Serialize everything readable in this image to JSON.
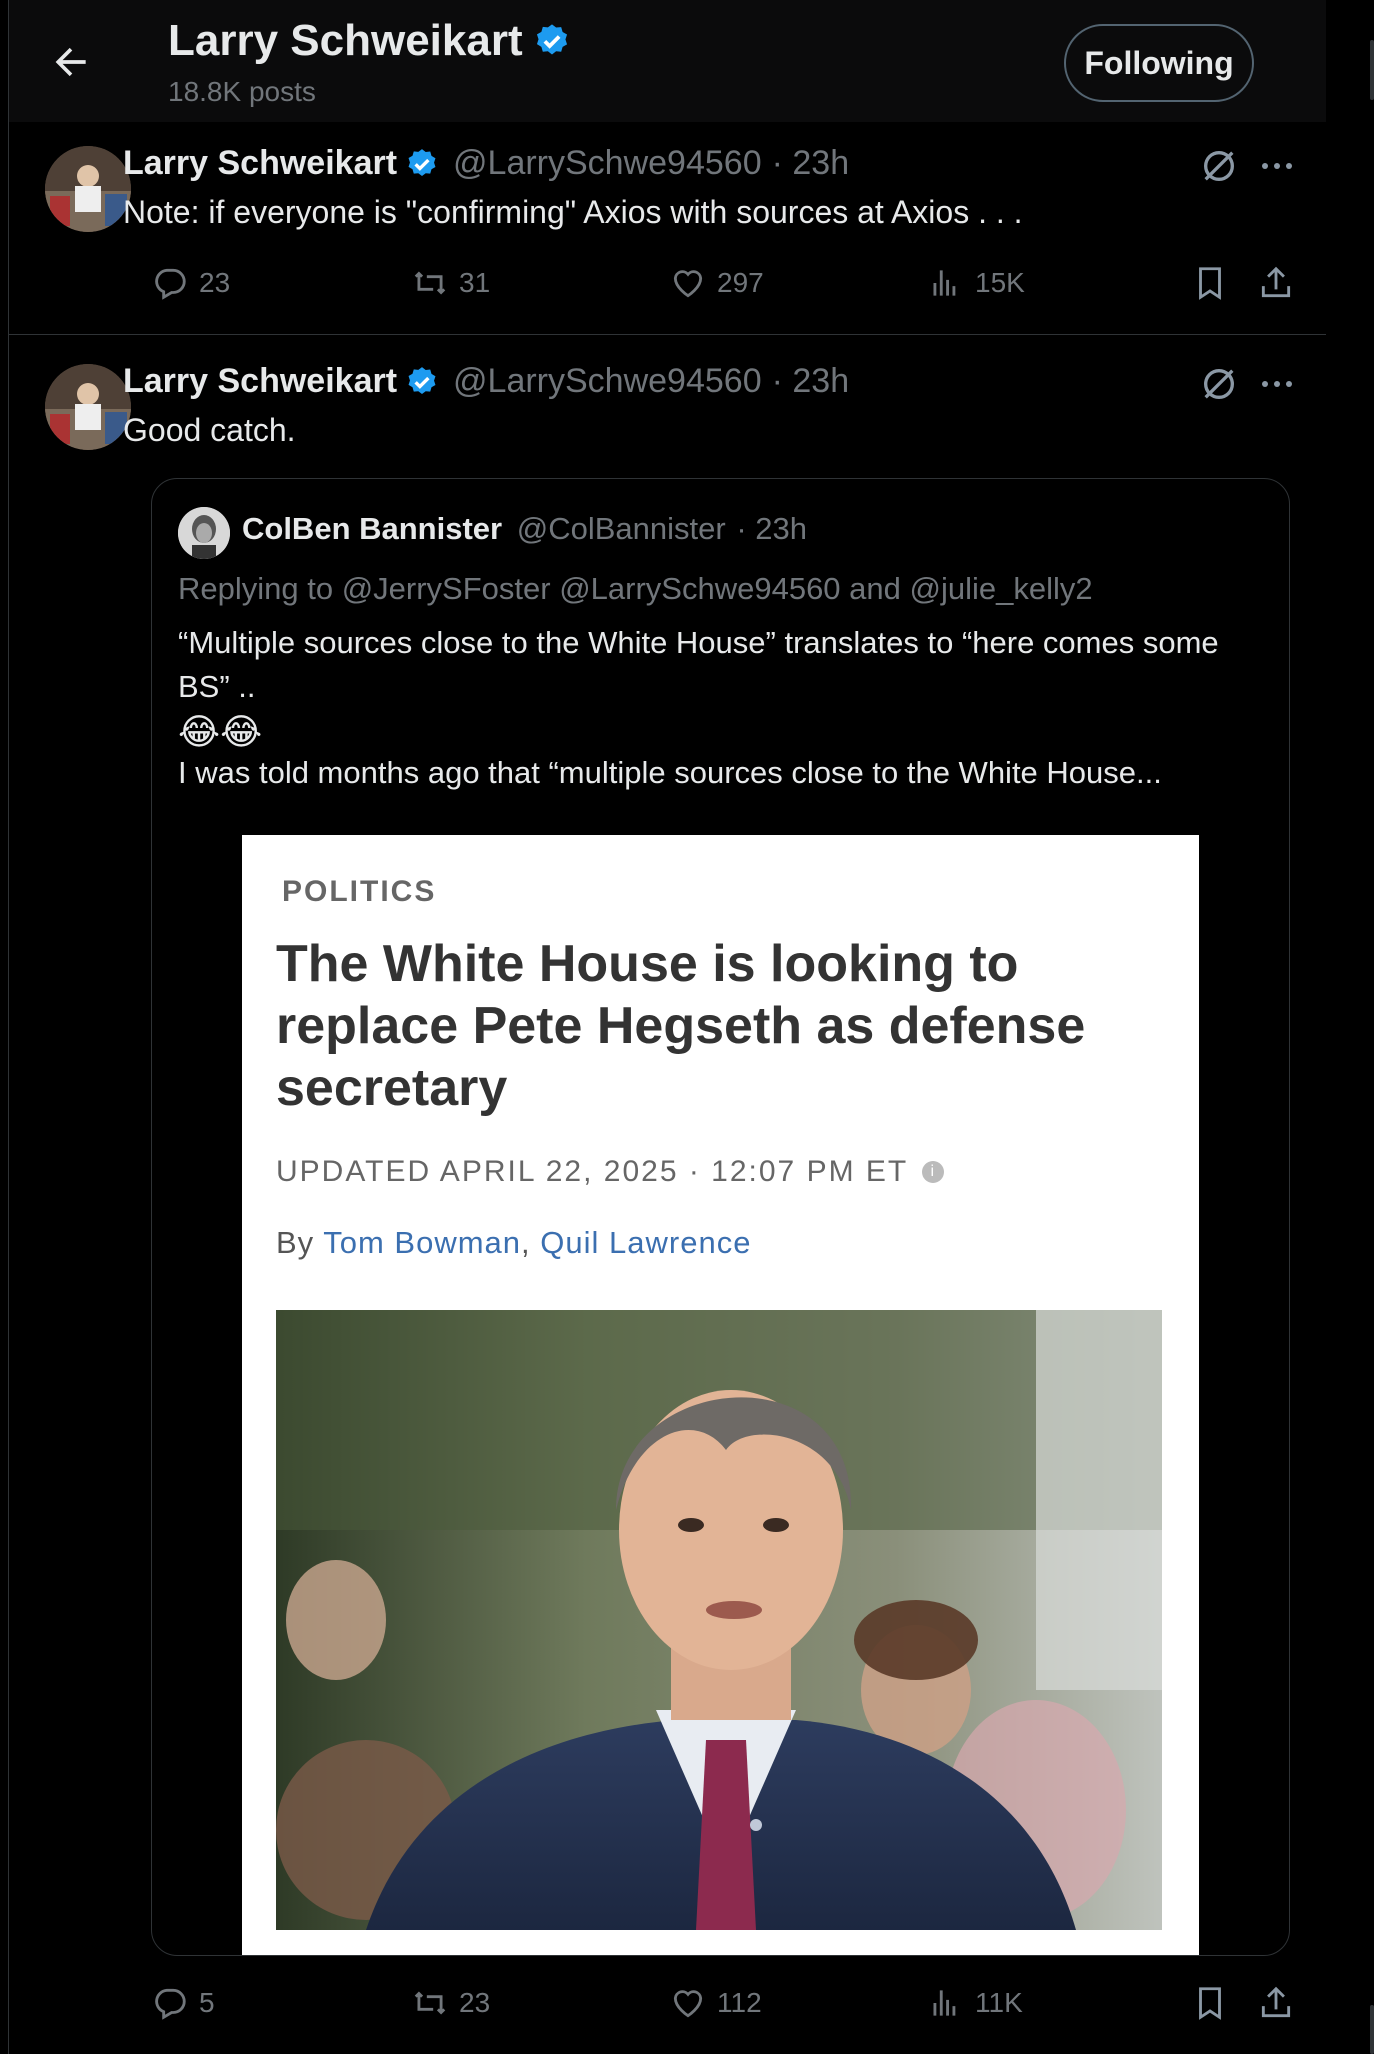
{
  "header": {
    "name": "Larry Schweikart",
    "posts": "18.8K posts",
    "follow_label": "Following"
  },
  "posts": [
    {
      "name": "Larry Schweikart",
      "handle": "@LarrySchwe94560",
      "time": "· 23h",
      "text": "Note: if everyone is \"confirming\" Axios with sources at Axios . . .",
      "replies": "23",
      "reposts": "31",
      "likes": "297",
      "views": "15K"
    },
    {
      "name": "Larry Schweikart",
      "handle": "@LarrySchwe94560",
      "time": "· 23h",
      "text": "Good catch.",
      "replies": "5",
      "reposts": "23",
      "likes": "112",
      "views": "11K",
      "quote": {
        "name": "ColBen Bannister",
        "handle": "@ColBannister",
        "time": "· 23h",
        "replying": "Replying to @JerrySFoster @LarrySchwe94560 and @julie_kelly2",
        "body": "“Multiple sources close to the White House” translates to “here comes some BS” ..",
        "emoji": "😂😂",
        "body2": "I was told months ago that “multiple sources close to the White House...",
        "card": {
          "category": "POLITICS",
          "title": "The White House is looking to replace Pete Hegseth as defense secretary",
          "updated": "UPDATED APRIL 22, 2025 · 12:07 PM ET",
          "by": "By",
          "author1": "Tom Bowman",
          "comma": ",",
          "author2": "Quil Lawrence"
        }
      }
    }
  ],
  "colors": {
    "background": "#000000",
    "muted": "#71767b",
    "verified": "#1d9bf0",
    "link": "#3b6fb0"
  },
  "icons": [
    "back-arrow-icon",
    "verified-badge-icon",
    "grok-icon",
    "more-icon",
    "reply-icon",
    "repost-icon",
    "like-icon",
    "views-icon",
    "bookmark-icon",
    "share-icon",
    "info-icon"
  ]
}
